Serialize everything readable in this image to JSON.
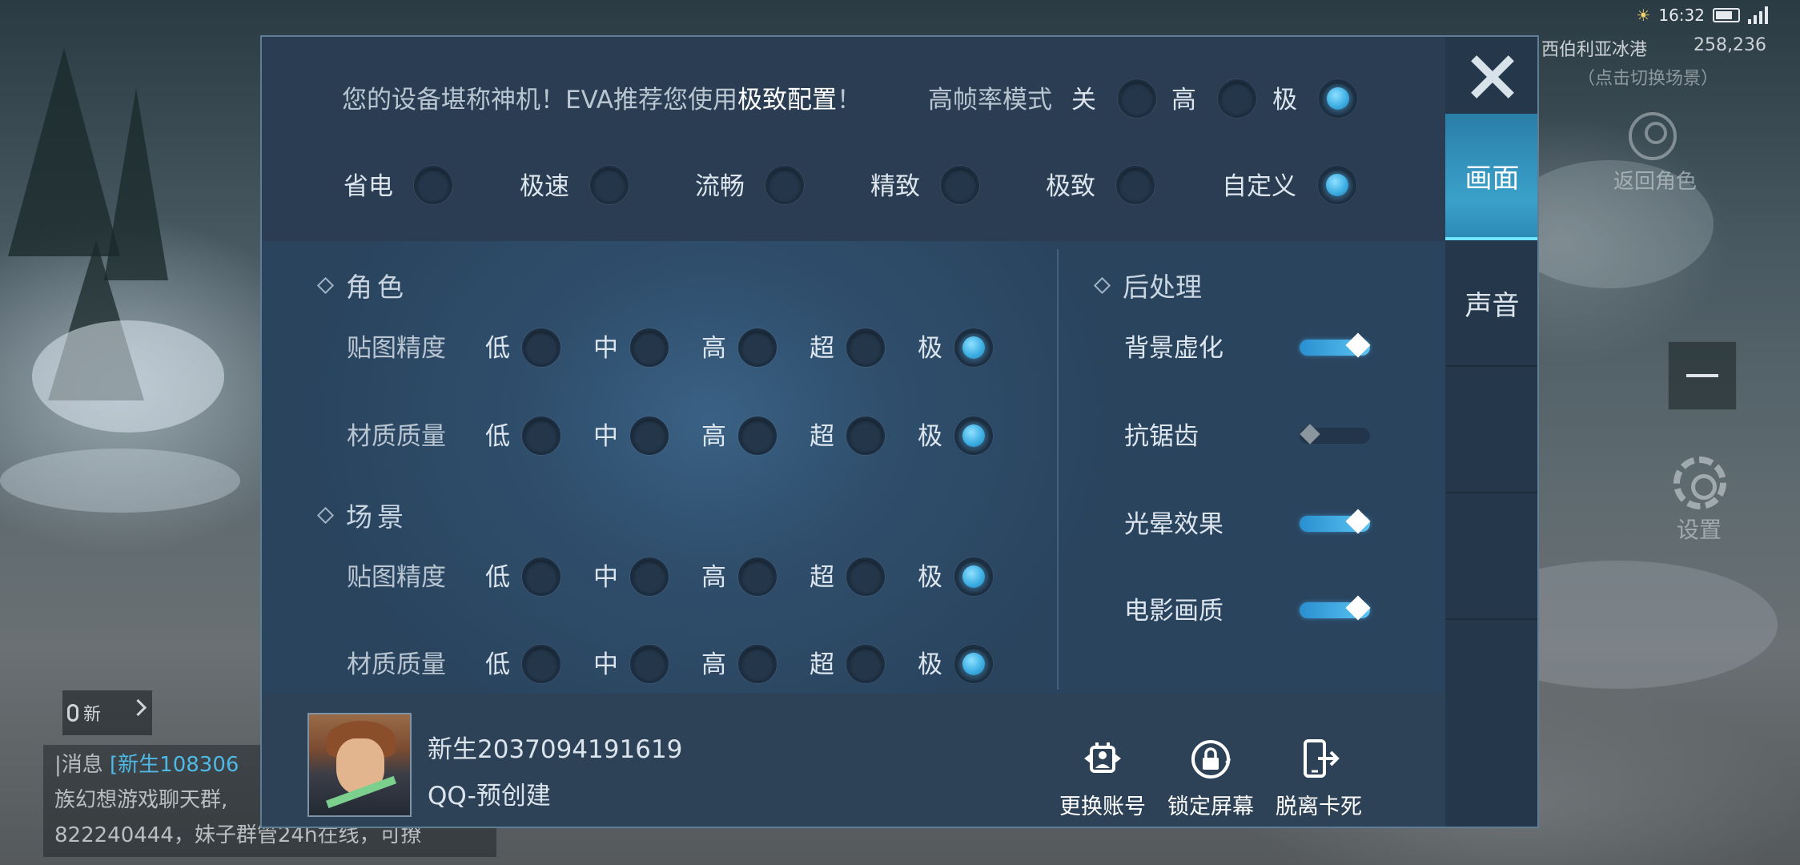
{
  "status_bar": {
    "time": "16:32"
  },
  "hud": {
    "location": "西伯利亚冰港",
    "coords": "258,236",
    "switch_scene": "（点击切换场景）",
    "return_role": "返回角色",
    "settings": "设置"
  },
  "voice": {
    "label": "新"
  },
  "chat": {
    "line1_prefix": "|消息",
    "line1_name": "[新生108306",
    "line2": "族幻想游戏聊天群,",
    "line3": "822240444，妹子群管24h在线，可撩"
  },
  "dialog": {
    "recommend_prefix": "您的设备堪称神机！EVA推荐您使用",
    "recommend_highlight": "极致配置",
    "recommend_suffix": "！",
    "hfr_label": "高帧率模式",
    "hfr_options": [
      {
        "label": "关",
        "selected": false
      },
      {
        "label": "高",
        "selected": false
      },
      {
        "label": "极",
        "selected": true
      }
    ],
    "presets": [
      {
        "label": "省电",
        "selected": false
      },
      {
        "label": "极速",
        "selected": false
      },
      {
        "label": "流畅",
        "selected": false
      },
      {
        "label": "精致",
        "selected": false
      },
      {
        "label": "极致",
        "selected": false
      },
      {
        "label": "自定义",
        "selected": true
      }
    ],
    "quality_levels": [
      "低",
      "中",
      "高",
      "超",
      "极"
    ],
    "character": {
      "title": "角色",
      "texture": {
        "label": "贴图精度",
        "selected_index": 4
      },
      "material": {
        "label": "材质质量",
        "selected_index": 4
      }
    },
    "scene": {
      "title": "场景",
      "texture": {
        "label": "贴图精度",
        "selected_index": 4
      },
      "material": {
        "label": "材质质量",
        "selected_index": 4
      }
    },
    "post": {
      "title": "后处理",
      "items": [
        {
          "label": "背景虚化",
          "on": true
        },
        {
          "label": "抗锯齿",
          "on": false
        },
        {
          "label": "光晕效果",
          "on": true
        },
        {
          "label": "电影画质",
          "on": true
        }
      ]
    },
    "account": {
      "name": "新生2037094191619",
      "platform": "QQ-预创建"
    },
    "actions": {
      "switch_account": "更换账号",
      "lock_screen": "锁定屏幕",
      "escape_stuck": "脱离卡死"
    },
    "tabs": {
      "graphics": "画面",
      "sound": "声音"
    }
  }
}
